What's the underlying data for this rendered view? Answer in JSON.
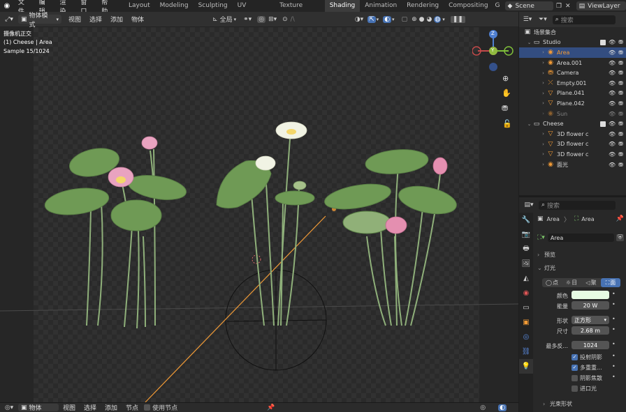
{
  "topbar": {
    "menus": [
      "文件",
      "编辑",
      "渲染",
      "窗口",
      "帮助"
    ],
    "workspaces": [
      "Layout",
      "Modeling",
      "Sculpting",
      "UV Editing",
      "Texture Paint",
      "Shading",
      "Animation",
      "Rendering",
      "Compositing",
      "G"
    ],
    "active_workspace": "Shading",
    "scene": "Scene",
    "view_layer": "ViewLayer"
  },
  "viewport_header": {
    "mode": "物体模式",
    "menus": [
      "视图",
      "选择",
      "添加",
      "物体"
    ],
    "orientation": "全局"
  },
  "viewport": {
    "camera_label": "摄像机正交",
    "object_label": "(1) Cheese | Area",
    "sample_label": "Sample 15/1024",
    "gizmo_axes": {
      "x": "X",
      "y": "Y",
      "z": "Z"
    }
  },
  "bottombar": {
    "mode": "物体",
    "menus": [
      "视图",
      "选择",
      "添加",
      "节点"
    ],
    "use_nodes": "使用节点"
  },
  "outliner": {
    "search_placeholder": "搜索",
    "root": "场景集合",
    "rows": [
      {
        "name": "Studio",
        "type": "collection",
        "level": 1
      },
      {
        "name": "Area",
        "type": "light",
        "level": 2,
        "selected": true
      },
      {
        "name": "Area.001",
        "type": "light",
        "level": 2
      },
      {
        "name": "Camera",
        "type": "camera",
        "level": 2
      },
      {
        "name": "Empty.001",
        "type": "empty",
        "level": 2
      },
      {
        "name": "Plane.041",
        "type": "mesh",
        "level": 2
      },
      {
        "name": "Plane.042",
        "type": "mesh",
        "level": 2
      },
      {
        "name": "Sun",
        "type": "light",
        "level": 2,
        "dim": true
      },
      {
        "name": "Cheese",
        "type": "collection",
        "level": 1
      },
      {
        "name": "3D flower c",
        "type": "mesh",
        "level": 2
      },
      {
        "name": "3D flower c",
        "type": "mesh",
        "level": 2
      },
      {
        "name": "3D flower c",
        "type": "mesh",
        "level": 2
      },
      {
        "name": "面光",
        "type": "light",
        "level": 2
      }
    ]
  },
  "properties": {
    "search_placeholder": "搜索",
    "breadcrumb": [
      "Area",
      "Area"
    ],
    "datablock": "Area",
    "sections": {
      "preview": "预览",
      "light": "灯光",
      "beam_shape": "光束形状"
    },
    "light_types": [
      "点",
      "日",
      "聚",
      "面"
    ],
    "active_light_type": "面",
    "fields": {
      "color_label": "颜色",
      "color_value": "#e6fbe3",
      "energy_label": "能量",
      "energy_value": "20 W",
      "shape_label": "形状",
      "shape_value": "正方形",
      "size_label": "尺寸",
      "size_value": "2.68 m",
      "max_bounces_label": "最多反...",
      "max_bounces_value": "1024"
    },
    "checkboxes": [
      {
        "label": "投射阴影",
        "checked": true
      },
      {
        "label": "多重重...",
        "checked": true
      },
      {
        "label": "阴影焦散",
        "checked": false
      },
      {
        "label": "进口光",
        "checked": false
      }
    ]
  },
  "colors": {
    "accent": "#4772b3",
    "selection_orange": "#f29b36",
    "leaf_green": "#6f9a55",
    "lotus_pink": "#e9a3c0"
  }
}
